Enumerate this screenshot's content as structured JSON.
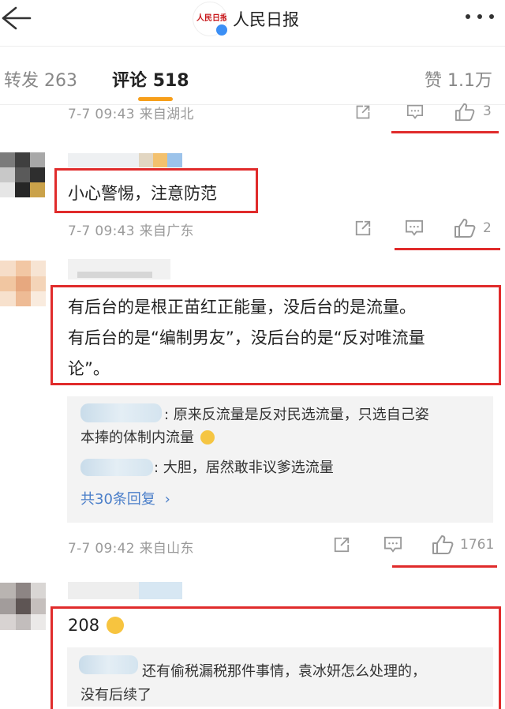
{
  "header": {
    "title": "人民日报"
  },
  "tabs": [
    {
      "label": "转发",
      "count": "263"
    },
    {
      "label": "评论",
      "count": "518"
    },
    {
      "label": "赞",
      "count": "1.1万"
    }
  ],
  "comments": [
    {
      "meta": "7-7 09:43 来自湖北",
      "likes": "3"
    },
    {
      "text": "小心警惕，注意防范",
      "meta": "7-7 09:43 来自广东",
      "likes": "2"
    },
    {
      "text_line1": "有后台的是根正苗红正能量，没后台的是流量。",
      "text_line2": "有后台的是“编制男友”，没后台的是“反对唯流量",
      "text_line3": "论”。",
      "replies": [
        {
          "text_line1": ": 原来反流量是反对民选流量，只选自己姿",
          "text_line2": "本捧的体制内流量"
        },
        {
          "text": ": 大胆，居然敢非议爹选流量"
        }
      ],
      "more_replies": "共30条回复",
      "meta": "7-7 09:42 来自山东",
      "likes": "1761"
    },
    {
      "text": "208",
      "reply": {
        "text_line1": "还有偷税漏税那件事情，袁冰妍怎么处理的，",
        "text_line2": "没有后续了"
      }
    }
  ]
}
